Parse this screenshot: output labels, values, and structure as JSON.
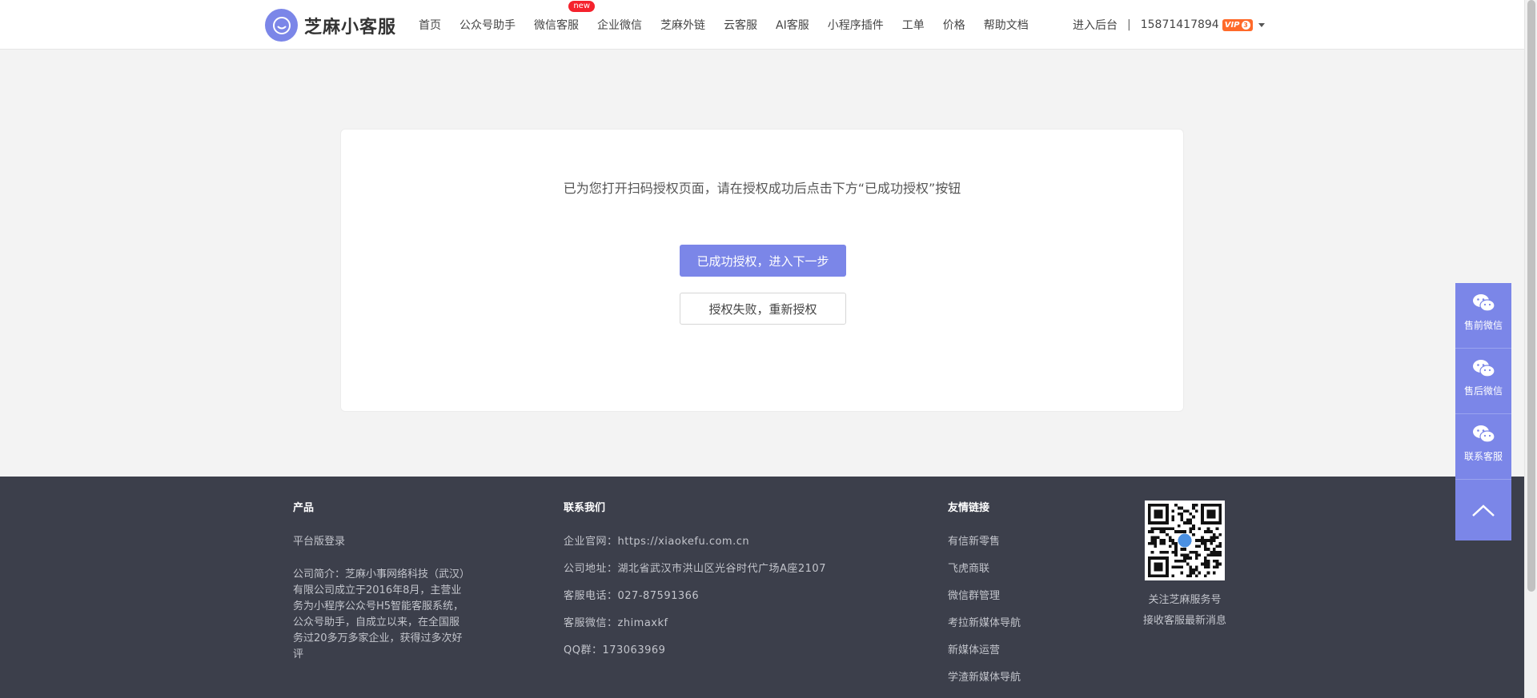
{
  "brand": {
    "name": "芝麻小客服"
  },
  "nav": {
    "items": [
      {
        "label": "首页"
      },
      {
        "label": "公众号助手"
      },
      {
        "label": "微信客服",
        "badge": "new"
      },
      {
        "label": "企业微信"
      },
      {
        "label": "芝麻外链"
      },
      {
        "label": "云客服"
      },
      {
        "label": "AI客服"
      },
      {
        "label": "小程序插件"
      },
      {
        "label": "工单"
      },
      {
        "label": "价格"
      },
      {
        "label": "帮助文档"
      }
    ]
  },
  "user": {
    "dashboard_label": "进入后台",
    "separator": "|",
    "phone": "15871417894",
    "vip_label": "VIP",
    "vip_level": "3"
  },
  "auth": {
    "message": "已为您打开扫码授权页面，请在授权成功后点击下方“已成功授权”按钮",
    "success_button": "已成功授权，进入下一步",
    "retry_button": "授权失败，重新授权"
  },
  "footer": {
    "product": {
      "title": "产品",
      "login_link": "平台版登录",
      "intro": "公司简介：芝麻小事网络科技（武汉）有限公司成立于2016年8月，主营业务为小程序公众号H5智能客服系统，公众号助手，自成立以来，在全国服务过20多万多家企业，获得过多次好评"
    },
    "contact": {
      "title": "联系我们",
      "website": "企业官网：https://xiaokefu.com.cn",
      "address": "公司地址：湖北省武汉市洪山区光谷时代广场A座2107",
      "phone": "客服电话：027-87591366",
      "wechat": "客服微信：zhimaxkf",
      "qq": "QQ群：173063969"
    },
    "links": {
      "title": "友情链接",
      "items": [
        "有信新零售",
        "飞虎商联",
        "微信群管理",
        "考拉新媒体导航",
        "新媒体运营",
        "学渣新媒体导航"
      ]
    },
    "qr": {
      "caption_1": "关注芝麻服务号",
      "caption_2": "接收客服最新消息"
    }
  },
  "sidebar": {
    "items": [
      {
        "label": "售前微信",
        "icon": "wechat-icon"
      },
      {
        "label": "售后微信",
        "icon": "wechat-icon"
      },
      {
        "label": "联系客服",
        "icon": "wechat-icon"
      }
    ],
    "top_icon": "chevron-up-icon"
  },
  "colors": {
    "accent": "#7b86e8",
    "footer_bg": "#3c3f4b",
    "badge_red": "#f5222d",
    "vip_orange": "#ff6a2a"
  }
}
